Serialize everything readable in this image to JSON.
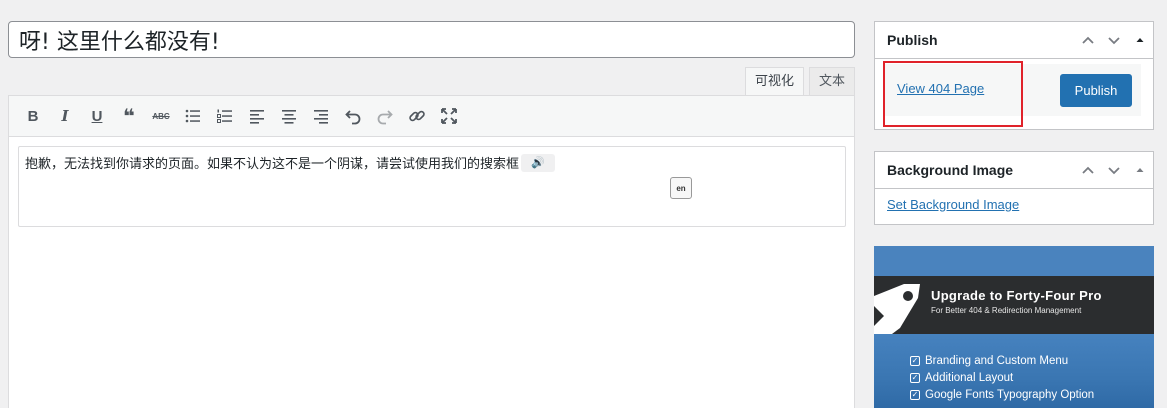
{
  "post": {
    "title": "呀! 这里什么都没有!"
  },
  "editor": {
    "tabs": [
      {
        "label": "可视化",
        "active": true
      },
      {
        "label": "文本",
        "active": false
      }
    ],
    "toolbar_icons": [
      "bold-icon",
      "italic-icon",
      "underline-icon",
      "blockquote-icon",
      "strikethrough-icon",
      "bullet-list-icon",
      "numbered-list-icon",
      "align-left-icon",
      "align-center-icon",
      "align-right-icon",
      "undo-icon",
      "redo-icon",
      "link-icon",
      "fullscreen-icon"
    ],
    "toolbar_glyphs": {
      "bold": "B",
      "italic": "I",
      "underline": "U",
      "quote": "❝",
      "strike": "ABC"
    },
    "content_text": "抱歉，无法找到你请求的页面。如果不认为这不是一个阴谋，请尝试使用我们的搜索框",
    "speaker_glyph": "🔊",
    "translate_glyph": "en"
  },
  "publish_box": {
    "title": "Publish",
    "view_link": "View 404 Page",
    "publish_label": "Publish",
    "highlight_color": "#e0222a"
  },
  "background_box": {
    "title": "Background Image",
    "link": "Set Background Image"
  },
  "promo": {
    "title": "Upgrade to Forty-Four Pro",
    "subtitle": "For Better 404 & Redirection Management",
    "features": [
      "Branding and Custom Menu",
      "Additional Layout",
      "Google Fonts Typography Option"
    ],
    "check_glyph": "✓"
  },
  "colors": {
    "accent": "#2271b1",
    "background": "#f0f0f1",
    "promo_blue": "#3d7ab8"
  }
}
